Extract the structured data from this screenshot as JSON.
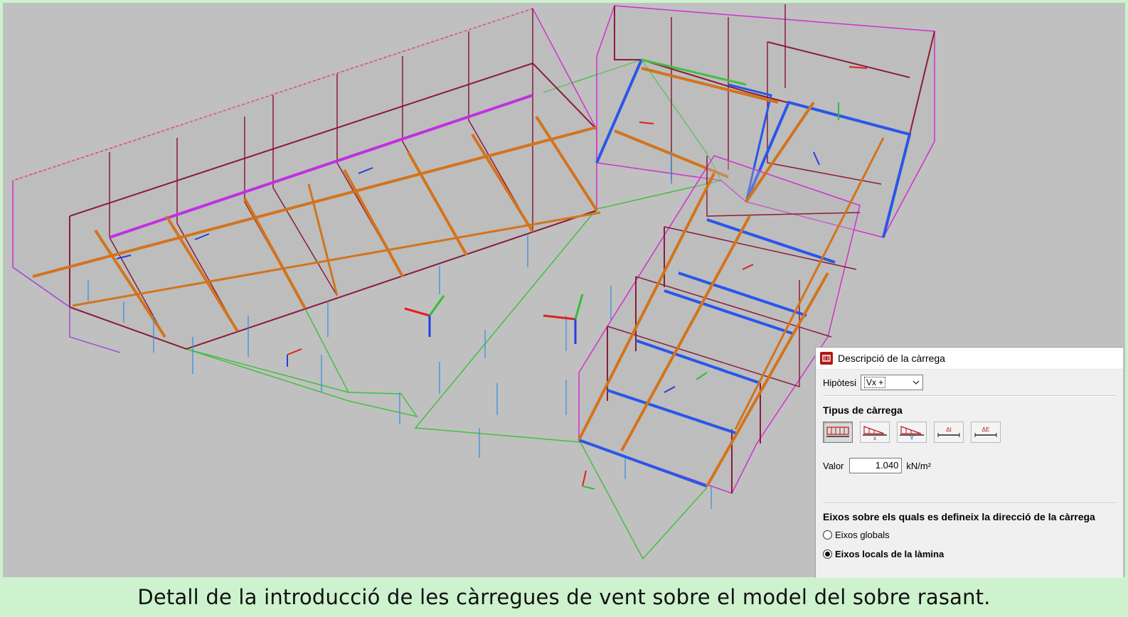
{
  "caption": "Detall de la introducció de les càrregues de vent sobre el model del sobre rasant.",
  "model_view": {
    "icon": "structural-3d-model",
    "colors": {
      "background": "#c0c0c0",
      "beam_orange": "#d2741c",
      "beam_blue": "#2a56e8",
      "frame_magenta": "#d030d0",
      "frame_dark_red": "#8a1c3a",
      "slab_outline_green": "#40c040",
      "load_line_blue": "#3a8fe0"
    }
  },
  "dialog": {
    "title": "Descripció de la càrrega",
    "title_icon": "load-dialog-icon",
    "hypothesis": {
      "label": "Hipòtesi",
      "selected": "Vx +"
    },
    "load_type": {
      "heading": "Tipus de càrrega",
      "buttons": [
        {
          "icon": "uniform-load-icon",
          "label": "",
          "active": true
        },
        {
          "icon": "linear-load-x-icon",
          "label": "x",
          "active": false
        },
        {
          "icon": "linear-load-y-icon",
          "label": "Y",
          "active": false
        },
        {
          "icon": "temperature-increment-icon",
          "label": "Δt",
          "active": false
        },
        {
          "icon": "strain-increment-icon",
          "label": "ΔE",
          "active": false
        }
      ]
    },
    "value": {
      "label": "Valor",
      "value": "1.040",
      "unit": "kN/m²"
    },
    "axes": {
      "heading": "Eixos sobre els quals es defineix la direcció de la càrrega",
      "options": [
        {
          "label": "Eixos globals",
          "checked": false
        },
        {
          "label": "Eixos locals de la làmina",
          "checked": true
        }
      ]
    }
  }
}
